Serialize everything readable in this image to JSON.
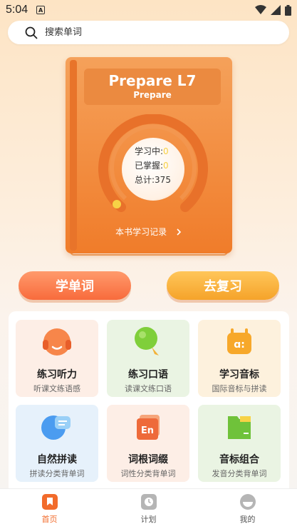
{
  "status": {
    "time": "5:04"
  },
  "search": {
    "placeholder": "搜索单词"
  },
  "book": {
    "title": "Prepare L7",
    "subtitle": "Prepare",
    "stats": {
      "learning_label": "学习中:",
      "learning_value": "0",
      "mastered_label": "已掌握:",
      "mastered_value": "0",
      "total_label": "总计:",
      "total_value": "375"
    },
    "record_link": "本书学习记录"
  },
  "actions": {
    "learn": "学单词",
    "review": "去复习"
  },
  "features": [
    {
      "title": "练习听力",
      "subtitle": "听课文练语感",
      "icon": "headphones-icon"
    },
    {
      "title": "练习口语",
      "subtitle": "读课文练口语",
      "icon": "microphone-icon"
    },
    {
      "title": "学习音标",
      "subtitle": "国际音标与拼读",
      "icon": "phonetic-icon"
    },
    {
      "title": "自然拼读",
      "subtitle": "拼读分类背单词",
      "icon": "chat-bubble-icon"
    },
    {
      "title": "词根词缀",
      "subtitle": "词性分类背单词",
      "icon": "en-card-icon"
    },
    {
      "title": "音标组合",
      "subtitle": "发音分类背单词",
      "icon": "folder-icon"
    }
  ],
  "tabs": [
    {
      "label": "首页",
      "icon": "bookmark-icon",
      "active": true
    },
    {
      "label": "计划",
      "icon": "clock-icon",
      "active": false
    },
    {
      "label": "我的",
      "icon": "profile-icon",
      "active": false
    }
  ],
  "colors": {
    "accent": "#f26b2b",
    "book": "#f07c2a",
    "review": "#f5a32a"
  }
}
